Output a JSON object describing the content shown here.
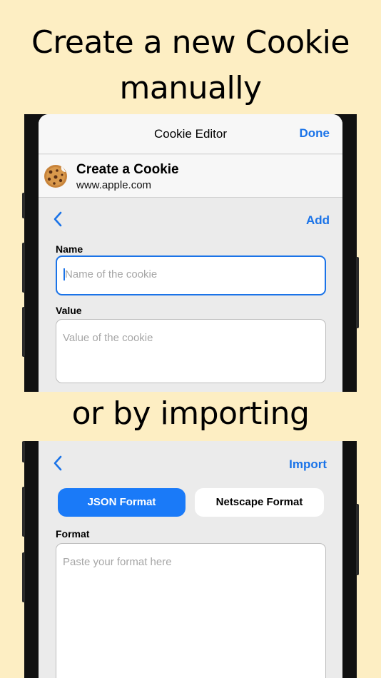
{
  "headline": {
    "line1": "Create a new Cookie",
    "line2": "manually",
    "line3": "or by importing"
  },
  "editor": {
    "title": "Cookie Editor",
    "done_label": "Done",
    "site_title": "Create a Cookie",
    "site_url": "www.apple.com",
    "add_label": "Add",
    "name_label": "Name",
    "name_placeholder": "Name of the cookie",
    "value_label": "Value",
    "value_placeholder": "Value of the cookie"
  },
  "import": {
    "import_label": "Import",
    "tabs": [
      {
        "label": "JSON Format",
        "active": true
      },
      {
        "label": "Netscape Format",
        "active": false
      }
    ],
    "format_label": "Format",
    "format_placeholder": "Paste your format here"
  },
  "colors": {
    "background": "#FDEEC3",
    "accent": "#1A73E8"
  },
  "icons": [
    "cookie-icon",
    "chevron-left-icon"
  ]
}
